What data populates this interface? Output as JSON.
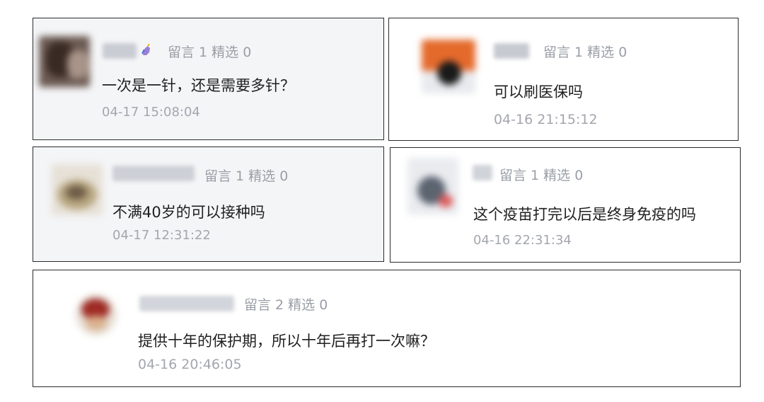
{
  "comments": [
    {
      "meta": "留言 1 精选 0",
      "text": "一次是一针，还是需要多针？",
      "time": "04-17 15:08:04"
    },
    {
      "meta": "留言 1 精选 0",
      "text": "可以刷医保吗",
      "time": "04-16 21:15:12"
    },
    {
      "meta": "留言 1 精选 0",
      "text": "不满40岁的可以接种吗",
      "time": "04-17 12:31:22"
    },
    {
      "meta": "留言 1 精选 0",
      "text": "这个疫苗打完以后是终身免疫的吗",
      "time": "04-16 22:31:34"
    },
    {
      "meta": "留言 2 精选 0",
      "text": "提供十年的保护期，所以十年后再打一次嘛？",
      "time": "04-16 20:46:05"
    }
  ],
  "colors": {
    "card_border": "#2b2b2b",
    "card_gray_bg": "#f4f5f7",
    "meta_text": "#9a9ea6",
    "body_text": "#1f1f1f"
  },
  "icons": [
    "avatar",
    "unicorn-emoji-icon"
  ]
}
